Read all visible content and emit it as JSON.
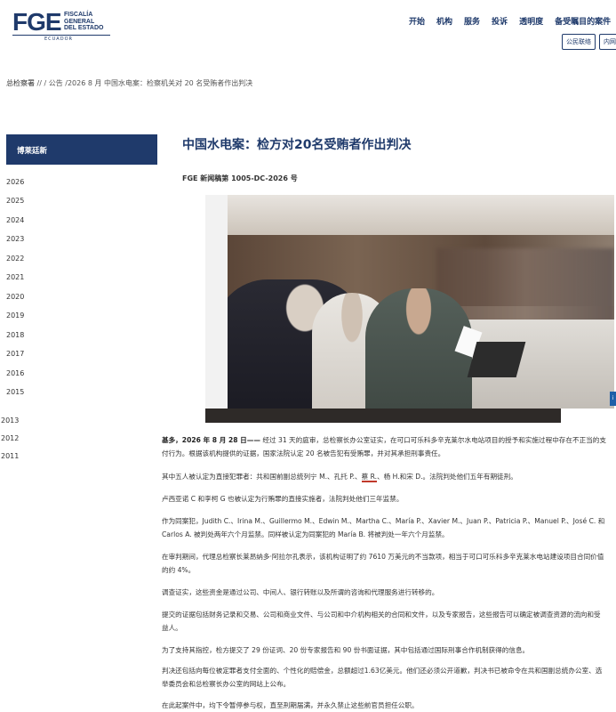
{
  "header": {
    "logo": {
      "mark": "FGE",
      "line1": "FISCALÍA",
      "line2": "GENERAL",
      "line3": "DEL ESTADO",
      "country": "ECUADOR"
    },
    "nav": [
      "开始",
      "机构",
      "服务",
      "投诉",
      "透明度",
      "备受瞩目的案件"
    ],
    "buttons": [
      "公民联络",
      "内网"
    ]
  },
  "breadcrumb": {
    "home": "总检察署",
    "sep1": " // ",
    "rest": "/ 公告 /2026 8 月 中国水电案：检察机关对 20 名受贿者作出判决"
  },
  "sidebar": {
    "title": "博莱廷新",
    "years": [
      "2026",
      "2025",
      "2024",
      "2023",
      "2022",
      "2021",
      "2020",
      "2019",
      "2018",
      "2017",
      "2016",
      "2015",
      "2013",
      "2012",
      "2011"
    ]
  },
  "article": {
    "title": "中国水电案：检方对20名受贿者作出判决",
    "boletin": "FGE 新闻稿第 1005-DC-2026 号",
    "photo_icon": "i",
    "p1_lead": "基多，2026 年 8 月 28 日——",
    "p1_rest": " 经过 31 天的庭审，总检察长办公室证实，在可口可乐科多辛克莱尔水电站项目的授予和实施过程中存在不正当的支付行为。根据该机构提供的证据，国家法院认定 20 名被告犯有受贿罪，并对其承担刑事责任。",
    "p2_a": "其中五人被认定为直接犯罪者：共和国前副总统列宁 M.、孔托 P.、",
    "p2_b": "蔡 R.",
    "p2_c": "、杨 H.和宋 D.。法院判处他们五年有期徒刑。",
    "p3": "卢西亚诺 C 和李柯 G 也被认定为行贿罪的直接实施者，法院判处他们三年监禁。",
    "p4": "作为同案犯，Judith C.、Irina M.、Guillermo M.、Edwin M.、Martha C.、María P.、Xavier M.、Juan P.、Patricia P.、Manuel P.、José C. 和 Carlos A. 被判处两年六个月监禁。同样被认定为同案犯的 María B. 将被判处一年六个月监禁。",
    "p5": "在审判期间，代理总检察长莱昂纳多·阿拉尔孔表示，该机构证明了约 7610 万美元的不当款项，相当于可口可乐科多辛克莱水电站建设项目合同价值的约 4%。",
    "p6": "调查证实，这些资金是通过公司、中间人、银行转账以及所谓的咨询和代理服务进行转移的。",
    "p7": "提交的证据包括财务记录和交易、公司和商业文件、与公司和中介机构相关的合同和文件，以及专家报告，这些报告可以确定被调查资源的流向和受益人。",
    "p8": "为了支持其指控，检方提交了 29 份证词、20 份专家报告和 90 份书面证据，其中包括通过国际刑事合作机制获得的信息。",
    "p9": "判决还包括向每位被定罪者支付全面的、个性化的赔偿金，总额超过1.63亿美元。他们还必须公开道歉，判决书已被命令在共和国副总统办公室、选举委员会和总检察长办公室的网站上公布。",
    "p10": "在此起案件中，均下令暂停参与权，直至刑期届满，并永久禁止这些前官员担任公职。"
  },
  "colors": {
    "brand": "#1f3a6b",
    "highlight_underline": "#c0392b"
  }
}
